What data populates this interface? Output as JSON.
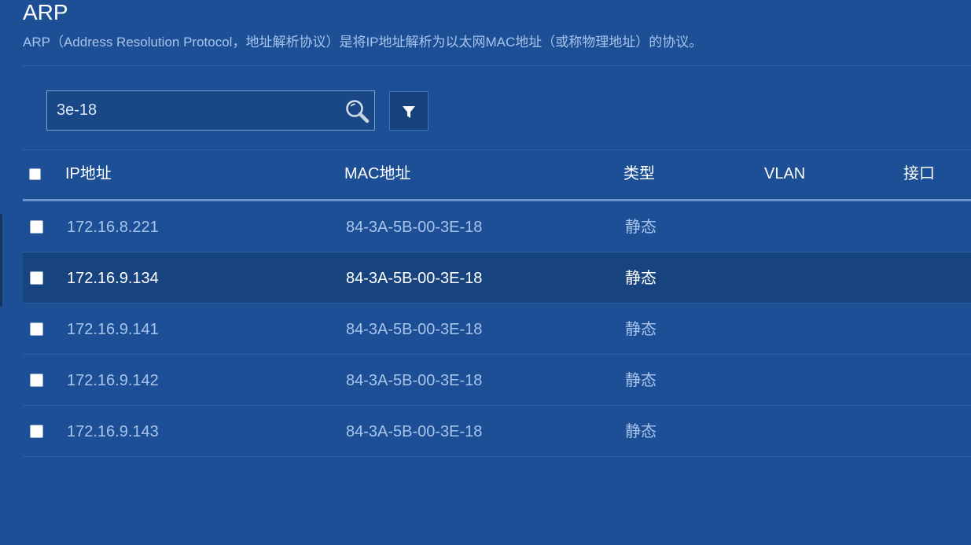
{
  "header": {
    "title": "ARP",
    "description": "ARP（Address Resolution Protocol，地址解析协议）是将IP地址解析为以太网MAC地址（或称物理地址）的协议。"
  },
  "search": {
    "value": "3e-18",
    "icon": "search-icon"
  },
  "filter": {
    "icon": "filter-icon"
  },
  "table": {
    "columns": [
      "IP地址",
      "MAC地址",
      "类型",
      "VLAN",
      "接口"
    ],
    "rows": [
      {
        "ip": "172.16.8.221",
        "mac": "84-3A-5B-00-3E-18",
        "type": "静态",
        "vlan": "",
        "interface": ""
      },
      {
        "ip": "172.16.9.134",
        "mac": "84-3A-5B-00-3E-18",
        "type": "静态",
        "vlan": "",
        "interface": ""
      },
      {
        "ip": "172.16.9.141",
        "mac": "84-3A-5B-00-3E-18",
        "type": "静态",
        "vlan": "",
        "interface": ""
      },
      {
        "ip": "172.16.9.142",
        "mac": "84-3A-5B-00-3E-18",
        "type": "静态",
        "vlan": "",
        "interface": ""
      },
      {
        "ip": "172.16.9.143",
        "mac": "84-3A-5B-00-3E-18",
        "type": "静态",
        "vlan": "",
        "interface": ""
      }
    ]
  },
  "colors": {
    "background": "#1c4f96",
    "row_highlight": "#17447f",
    "muted_text": "#a9c4ea"
  }
}
